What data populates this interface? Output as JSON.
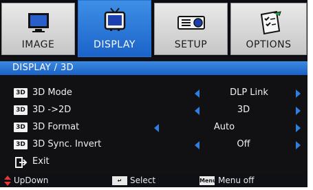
{
  "tabs": [
    {
      "label": "IMAGE",
      "icon": "monitor-icon",
      "active": false
    },
    {
      "label": "DISPLAY",
      "icon": "tv-icon",
      "active": true
    },
    {
      "label": "SETUP",
      "icon": "projector-icon",
      "active": false
    },
    {
      "label": "OPTIONS",
      "icon": "clipboard-check-icon",
      "active": false
    }
  ],
  "section_title": "DISPLAY / 3D",
  "badge_text": "3D",
  "rows": [
    {
      "label": "3D Mode",
      "value": "DLP Link"
    },
    {
      "label": "3D ->2D",
      "value": "3D"
    },
    {
      "label": "3D Format",
      "value": "Auto"
    },
    {
      "label": "3D Sync. Invert",
      "value": "Off"
    }
  ],
  "exit_label": "Exit",
  "footer": {
    "updown_label": "UpDown",
    "select_label": "Select",
    "menu_key": "Menu",
    "menu_label": "Menu off"
  },
  "colors": {
    "accent": "#1b63c9",
    "arrow": "#2f7fe0",
    "tab_bg": "#d9d9d9"
  }
}
